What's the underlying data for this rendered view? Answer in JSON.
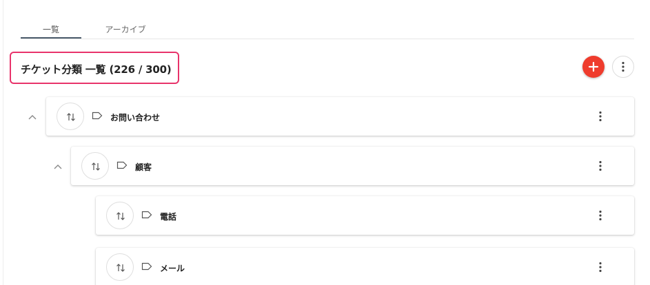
{
  "tabs": [
    {
      "label": "一覧",
      "active": true
    },
    {
      "label": "アーカイブ",
      "active": false
    }
  ],
  "header": {
    "title": "チケット分類 一覧 (226 / 300)",
    "highlight_color": "#e8326a"
  },
  "actions": {
    "add_icon": "plus-icon",
    "add_color": "#ef3c2d",
    "more_icon": "more-vertical-icon"
  },
  "tree": [
    {
      "label": "お問い合わせ",
      "level": 0,
      "expanded": true,
      "icon": "tag-icon"
    },
    {
      "label": "顧客",
      "level": 1,
      "expanded": true,
      "icon": "tag-icon"
    },
    {
      "label": "電話",
      "level": 2,
      "icon": "tag-icon"
    },
    {
      "label": "メール",
      "level": 2,
      "icon": "tag-icon"
    }
  ]
}
